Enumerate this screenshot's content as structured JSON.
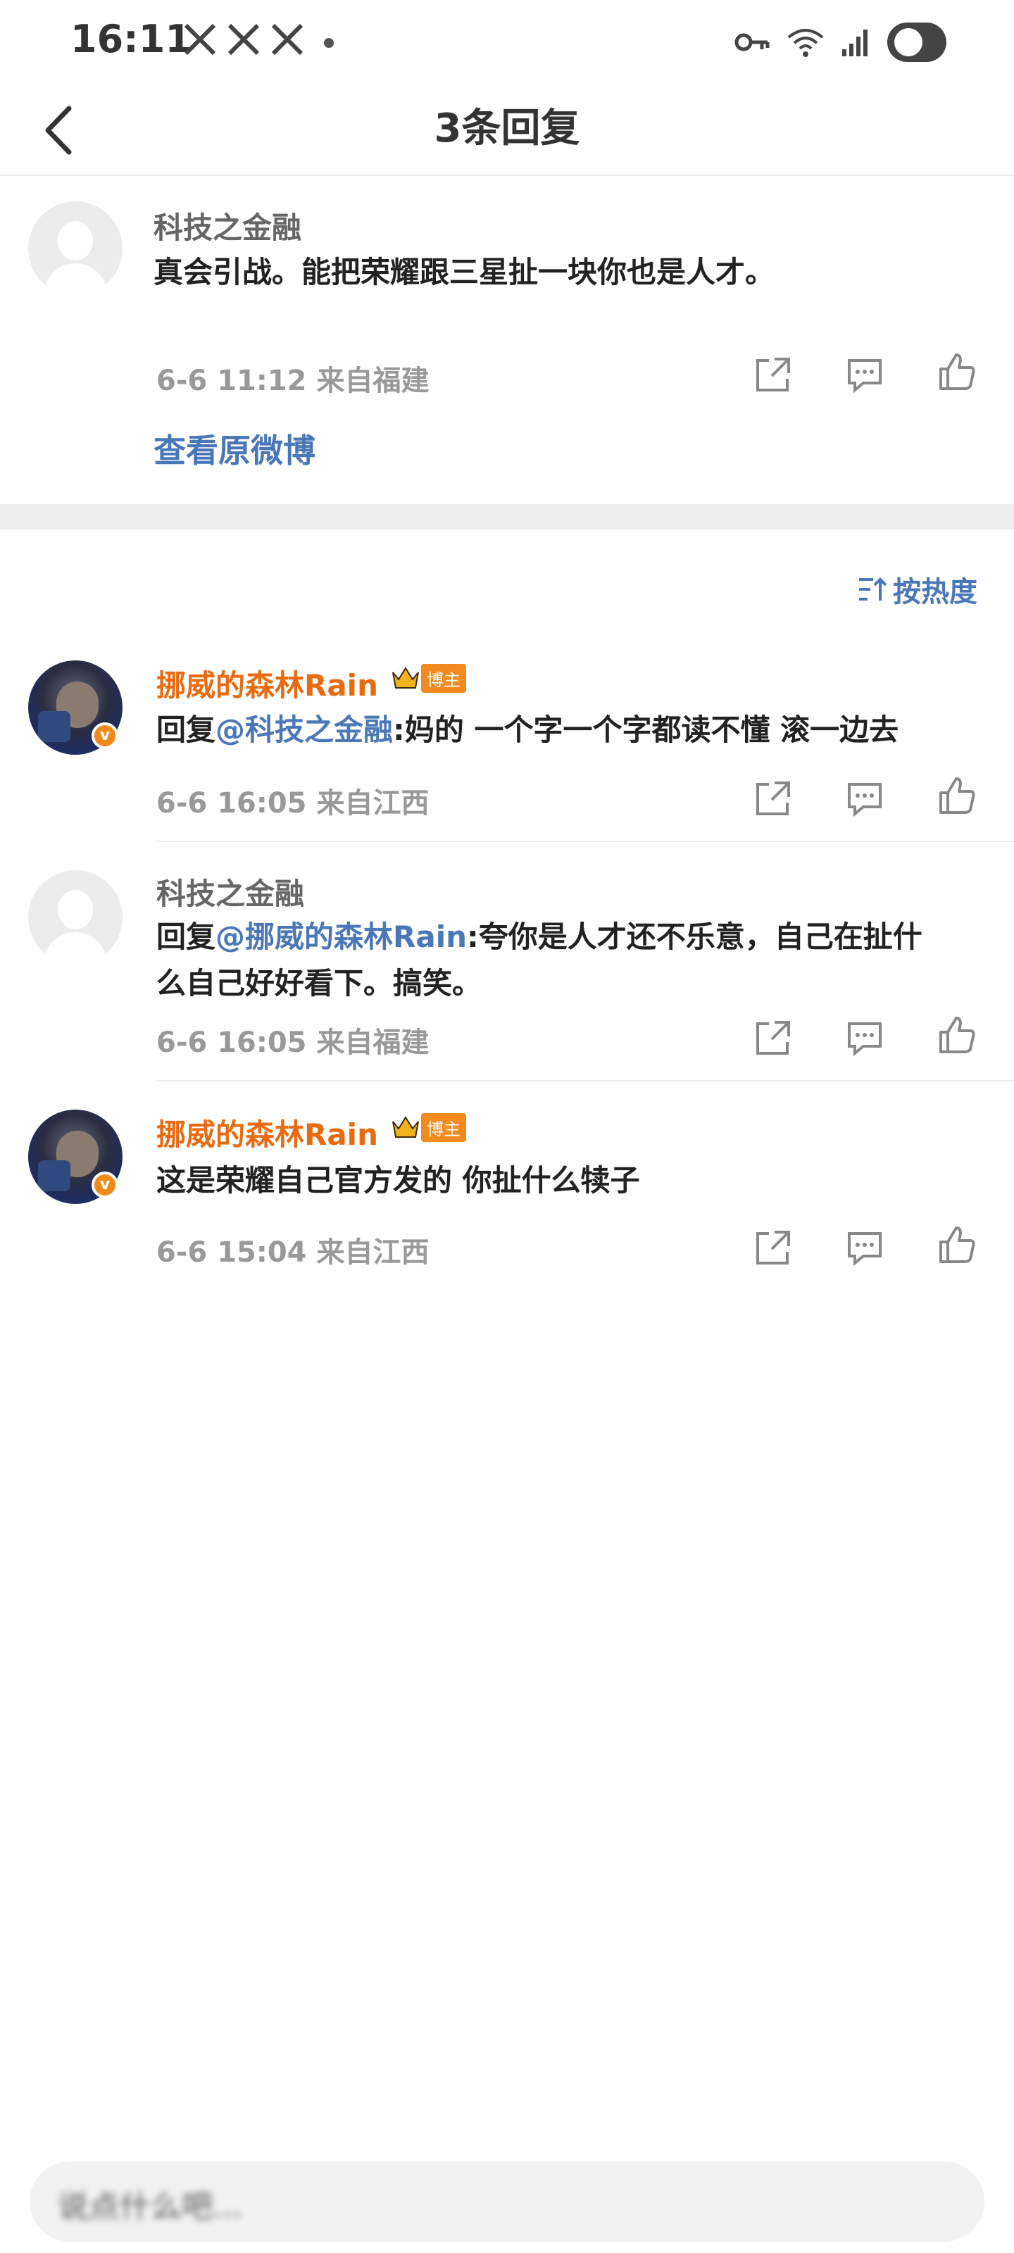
{
  "status_bar": {
    "time": "16:11"
  },
  "nav": {
    "title": "3条回复"
  },
  "root_comment": {
    "username": "科技之金融",
    "text": "真会引战。能把荣耀跟三星扯一块你也是人才。",
    "meta": "6-6 11:12  来自福建",
    "view_original": "查看原微博"
  },
  "sort": {
    "label": "按热度"
  },
  "replies": [
    {
      "username": "挪威的森林Rain",
      "badge": "博主",
      "reply_prefix": "回复",
      "mention": "@科技之金融",
      "text": ":妈的 一个字一个字都读不懂 滚一边去",
      "meta": "6-6 16:05  来自江西"
    },
    {
      "username": "科技之金融",
      "reply_prefix": "回复",
      "mention": "@挪威的森林Rain",
      "text_line1": ":夸你是人才还不乐意，自己在扯什",
      "text_line2": "么自己好好看下。搞笑。",
      "meta": "6-6 16:05  来自福建"
    },
    {
      "username": "挪威的森林Rain",
      "badge": "博主",
      "text": "这是荣耀自己官方发的 你扯什么犊子",
      "meta": "6-6 15:04  来自江西"
    }
  ],
  "input": {
    "placeholder": "说点什么吧..."
  },
  "colors": {
    "accent_blue": "#4a77b8",
    "username_orange": "#e86b10",
    "badge_orange": "#f28a1d"
  }
}
